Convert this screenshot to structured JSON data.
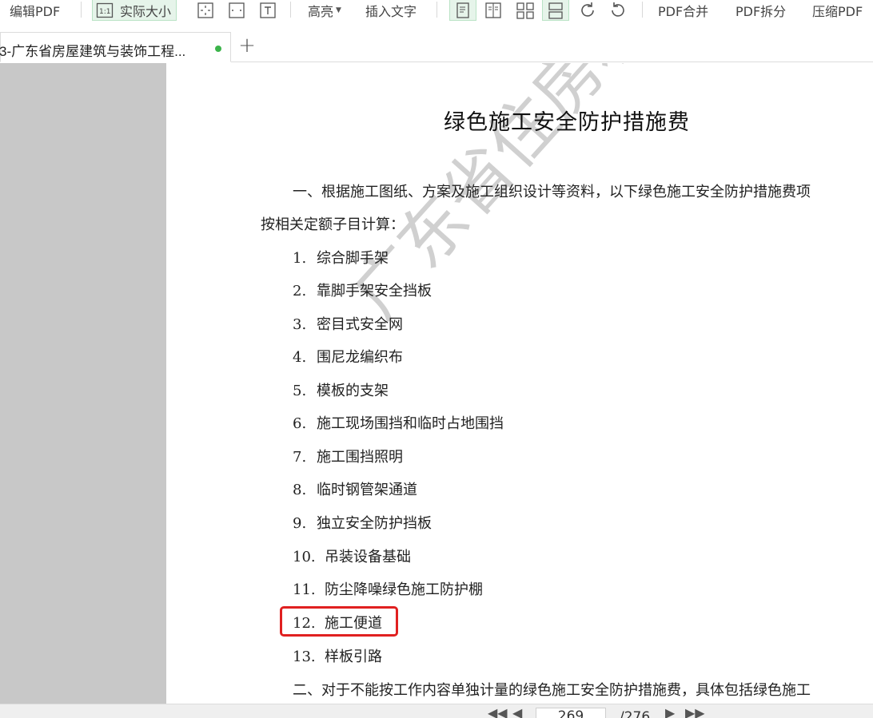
{
  "toolbar": {
    "edit_pdf": "编辑PDF",
    "actual_size": "实际大小",
    "highlight": "高亮",
    "insert_text": "插入文字",
    "pdf_merge": "PDF合并",
    "pdf_split": "PDF拆分",
    "compress_pdf": "压缩PDF"
  },
  "tab": {
    "title": "3-广东省房屋建筑与装饰工程...",
    "status_color": "#3cb44b"
  },
  "document": {
    "title": "绿色施工安全防护措施费",
    "para1_line1": "一、根据施工图纸、方案及施工组织设计等资料，以下绿色施工安全防护措施费项",
    "para1_line2": "按相关定额子目计算：",
    "items": [
      {
        "num": "1.",
        "text": "综合脚手架"
      },
      {
        "num": "2.",
        "text": "靠脚手架安全挡板"
      },
      {
        "num": "3.",
        "text": "密目式安全网"
      },
      {
        "num": "4.",
        "text": "围尼龙编织布"
      },
      {
        "num": "5.",
        "text": "模板的支架"
      },
      {
        "num": "6.",
        "text": "施工现场围挡和临时占地围挡"
      },
      {
        "num": "7.",
        "text": "施工围挡照明"
      },
      {
        "num": "8.",
        "text": "临时钢管架通道"
      },
      {
        "num": "9.",
        "text": "独立安全防护挡板"
      },
      {
        "num": "10.",
        "text": "吊装设备基础"
      },
      {
        "num": "11.",
        "text": "防尘降噪绿色施工防护棚"
      },
      {
        "num": "12.",
        "text": "施工便道"
      },
      {
        "num": "13.",
        "text": "样板引路"
      }
    ],
    "para2": "二、对于不能按工作内容单独计量的绿色施工安全防护措施费，具体包括绿色施工",
    "watermark": "广东省住房和城乡建设厅"
  },
  "statusbar": {
    "current_page": "269",
    "total_pages": "/276"
  },
  "colors": {
    "highlight_box": "#e02020",
    "gutter": "#c8c8c8"
  }
}
